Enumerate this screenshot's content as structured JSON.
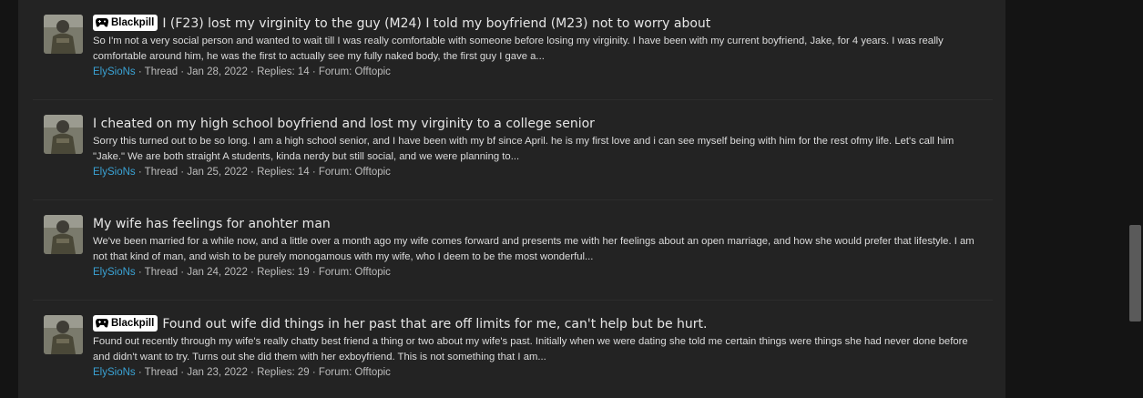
{
  "threads": [
    {
      "badge": "Blackpill",
      "has_badge": true,
      "title": "I (F23) lost my virginity to the guy (M24) I told my boyfriend (M23) not to worry about",
      "snippet": "So I'm not a very social person and wanted to wait till I was really comfortable with someone before losing my virginity. I have been with my current boyfriend, Jake, for 4 years. I was really comfortable around him, he was the first to actually see my fully naked body, the first guy I gave a...",
      "author": "ElySioNs",
      "type": "Thread",
      "date": "Jan 28, 2022",
      "replies": "Replies: 14",
      "forum": "Forum: Offtopic"
    },
    {
      "badge": "",
      "has_badge": false,
      "title": "I cheated on my high school boyfriend and lost my virginity to a college senior",
      "snippet": "Sorry this turned out to be so long. I am a high school senior, and I have been with my bf since April. he is my first love and i can see myself being with him for the rest ofmy life. Let's call him \"Jake.\" We are both straight A students, kinda nerdy but still social, and we were planning to...",
      "author": "ElySioNs",
      "type": "Thread",
      "date": "Jan 25, 2022",
      "replies": "Replies: 14",
      "forum": "Forum: Offtopic"
    },
    {
      "badge": "",
      "has_badge": false,
      "title": "My wife has feelings for anohter man",
      "snippet": "We've been married for a while now, and a little over a month ago my wife comes forward and presents me with her feelings about an open marriage, and how she would prefer that lifestyle. I am not that kind of man, and wish to be purely monogamous with my wife, who I deem to be the most wonderful...",
      "author": "ElySioNs",
      "type": "Thread",
      "date": "Jan 24, 2022",
      "replies": "Replies: 19",
      "forum": "Forum: Offtopic"
    },
    {
      "badge": "Blackpill",
      "has_badge": true,
      "title": "Found out wife did things in her past that are off limits for me, can't help but be hurt.",
      "snippet": "Found out recently through my wife's really chatty best friend a thing or two about my wife's past. Initially when we were dating she told me certain things were things she had never done before and didn't want to try. Turns out she did them with her exboyfriend. This is not something that I am...",
      "author": "ElySioNs",
      "type": "Thread",
      "date": "Jan 23, 2022",
      "replies": "Replies: 29",
      "forum": "Forum: Offtopic"
    }
  ],
  "separator": " · ",
  "colors": {
    "background": "#141414",
    "panel": "#232323",
    "author_link": "#3aa2d4",
    "badge_bg": "#ffffff",
    "badge_text": "#000000"
  },
  "icons": {
    "badge": "gamepad-icon",
    "avatar": "user-avatar"
  }
}
